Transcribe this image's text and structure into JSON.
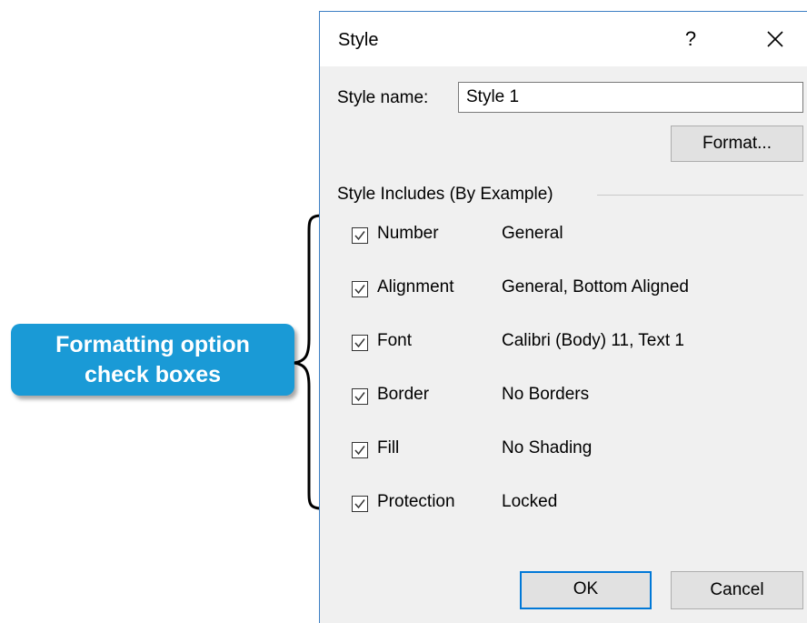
{
  "callout": {
    "line1": "Formatting option",
    "line2": "check boxes",
    "color": "#1a9ad6"
  },
  "dialog": {
    "title": "Style",
    "help_label": "?",
    "close_icon": "close-icon",
    "style_name_label": "Style name:",
    "style_name_value": "Style 1",
    "format_button": "Format...",
    "group_label": "Style Includes (By Example)",
    "options": [
      {
        "label": "Number",
        "value": "General",
        "checked": true
      },
      {
        "label": "Alignment",
        "value": "General, Bottom Aligned",
        "checked": true
      },
      {
        "label": "Font",
        "value": "Calibri (Body) 11, Text 1",
        "checked": true
      },
      {
        "label": "Border",
        "value": "No Borders",
        "checked": true
      },
      {
        "label": "Fill",
        "value": "No Shading",
        "checked": true
      },
      {
        "label": "Protection",
        "value": "Locked",
        "checked": true
      }
    ],
    "ok_button": "OK",
    "cancel_button": "Cancel"
  }
}
